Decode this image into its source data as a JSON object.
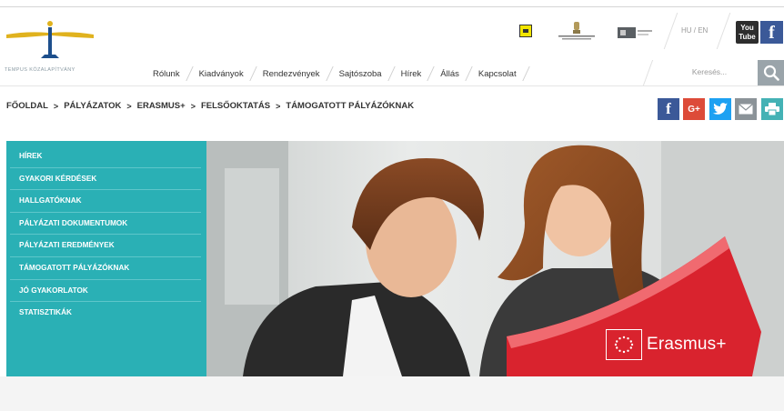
{
  "brand": {
    "logo_text": "TEMPUS KÖZALAPÍTVÁNY",
    "accent_color": "#2ab0b5"
  },
  "header": {
    "lang_switch": "HU / EN",
    "social": {
      "youtube_label": "You Tube",
      "facebook_label": "f"
    },
    "partner_logo_icons": [
      "bmk-logo-icon",
      "government-crest-icon",
      "ministry-logo-icon"
    ]
  },
  "nav": {
    "items": [
      {
        "label": "Rólunk"
      },
      {
        "label": "Kiadványok"
      },
      {
        "label": "Rendezvények"
      },
      {
        "label": "Sajtószoba"
      },
      {
        "label": "Hírek"
      },
      {
        "label": "Állás"
      },
      {
        "label": "Kapcsolat"
      }
    ],
    "search_placeholder": "Keresés..."
  },
  "breadcrumb": {
    "items": [
      {
        "label": "FŐOLDAL"
      },
      {
        "label": "PÁLYÁZATOK"
      },
      {
        "label": "ERASMUS+"
      },
      {
        "label": "FELSŐOKTATÁS"
      },
      {
        "label": "TÁMOGATOTT PÁLYÁZÓKNAK"
      }
    ],
    "separator": ">"
  },
  "share": {
    "facebook": "f",
    "googleplus": "G+",
    "icons": [
      "facebook-icon",
      "google-plus-icon",
      "twitter-icon",
      "mail-icon",
      "print-icon"
    ]
  },
  "sidebar": {
    "items": [
      {
        "label": "HÍREK"
      },
      {
        "label": "GYAKORI KÉRDÉSEK"
      },
      {
        "label": "HALLGATÓKNAK"
      },
      {
        "label": "PÁLYÁZATI DOKUMENTUMOK"
      },
      {
        "label": "PÁLYÁZATI EREDMÉNYEK"
      },
      {
        "label": "TÁMOGATOTT PÁLYÁZÓKNAK"
      },
      {
        "label": "JÓ GYAKORLATOK"
      },
      {
        "label": "STATISZTIKÁK"
      }
    ]
  },
  "hero": {
    "erasmus_label": "Erasmus+"
  }
}
